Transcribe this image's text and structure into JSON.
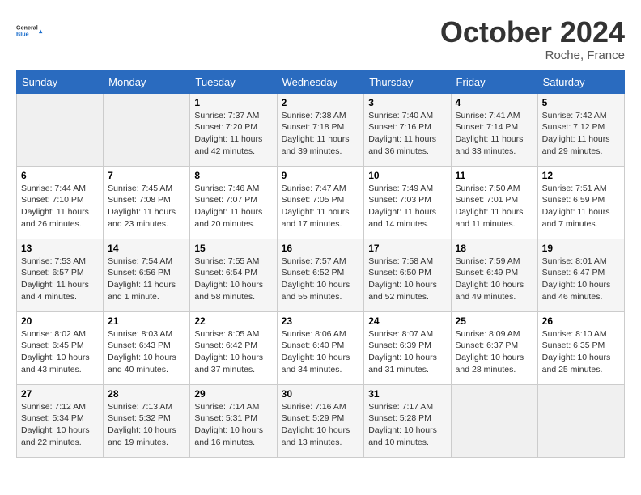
{
  "header": {
    "logo_line1": "General",
    "logo_line2": "Blue",
    "month": "October 2024",
    "location": "Roche, France"
  },
  "days_of_week": [
    "Sunday",
    "Monday",
    "Tuesday",
    "Wednesday",
    "Thursday",
    "Friday",
    "Saturday"
  ],
  "weeks": [
    [
      null,
      null,
      {
        "day": "1",
        "sunrise": "Sunrise: 7:37 AM",
        "sunset": "Sunset: 7:20 PM",
        "daylight": "Daylight: 11 hours and 42 minutes."
      },
      {
        "day": "2",
        "sunrise": "Sunrise: 7:38 AM",
        "sunset": "Sunset: 7:18 PM",
        "daylight": "Daylight: 11 hours and 39 minutes."
      },
      {
        "day": "3",
        "sunrise": "Sunrise: 7:40 AM",
        "sunset": "Sunset: 7:16 PM",
        "daylight": "Daylight: 11 hours and 36 minutes."
      },
      {
        "day": "4",
        "sunrise": "Sunrise: 7:41 AM",
        "sunset": "Sunset: 7:14 PM",
        "daylight": "Daylight: 11 hours and 33 minutes."
      },
      {
        "day": "5",
        "sunrise": "Sunrise: 7:42 AM",
        "sunset": "Sunset: 7:12 PM",
        "daylight": "Daylight: 11 hours and 29 minutes."
      }
    ],
    [
      {
        "day": "6",
        "sunrise": "Sunrise: 7:44 AM",
        "sunset": "Sunset: 7:10 PM",
        "daylight": "Daylight: 11 hours and 26 minutes."
      },
      {
        "day": "7",
        "sunrise": "Sunrise: 7:45 AM",
        "sunset": "Sunset: 7:08 PM",
        "daylight": "Daylight: 11 hours and 23 minutes."
      },
      {
        "day": "8",
        "sunrise": "Sunrise: 7:46 AM",
        "sunset": "Sunset: 7:07 PM",
        "daylight": "Daylight: 11 hours and 20 minutes."
      },
      {
        "day": "9",
        "sunrise": "Sunrise: 7:47 AM",
        "sunset": "Sunset: 7:05 PM",
        "daylight": "Daylight: 11 hours and 17 minutes."
      },
      {
        "day": "10",
        "sunrise": "Sunrise: 7:49 AM",
        "sunset": "Sunset: 7:03 PM",
        "daylight": "Daylight: 11 hours and 14 minutes."
      },
      {
        "day": "11",
        "sunrise": "Sunrise: 7:50 AM",
        "sunset": "Sunset: 7:01 PM",
        "daylight": "Daylight: 11 hours and 11 minutes."
      },
      {
        "day": "12",
        "sunrise": "Sunrise: 7:51 AM",
        "sunset": "Sunset: 6:59 PM",
        "daylight": "Daylight: 11 hours and 7 minutes."
      }
    ],
    [
      {
        "day": "13",
        "sunrise": "Sunrise: 7:53 AM",
        "sunset": "Sunset: 6:57 PM",
        "daylight": "Daylight: 11 hours and 4 minutes."
      },
      {
        "day": "14",
        "sunrise": "Sunrise: 7:54 AM",
        "sunset": "Sunset: 6:56 PM",
        "daylight": "Daylight: 11 hours and 1 minute."
      },
      {
        "day": "15",
        "sunrise": "Sunrise: 7:55 AM",
        "sunset": "Sunset: 6:54 PM",
        "daylight": "Daylight: 10 hours and 58 minutes."
      },
      {
        "day": "16",
        "sunrise": "Sunrise: 7:57 AM",
        "sunset": "Sunset: 6:52 PM",
        "daylight": "Daylight: 10 hours and 55 minutes."
      },
      {
        "day": "17",
        "sunrise": "Sunrise: 7:58 AM",
        "sunset": "Sunset: 6:50 PM",
        "daylight": "Daylight: 10 hours and 52 minutes."
      },
      {
        "day": "18",
        "sunrise": "Sunrise: 7:59 AM",
        "sunset": "Sunset: 6:49 PM",
        "daylight": "Daylight: 10 hours and 49 minutes."
      },
      {
        "day": "19",
        "sunrise": "Sunrise: 8:01 AM",
        "sunset": "Sunset: 6:47 PM",
        "daylight": "Daylight: 10 hours and 46 minutes."
      }
    ],
    [
      {
        "day": "20",
        "sunrise": "Sunrise: 8:02 AM",
        "sunset": "Sunset: 6:45 PM",
        "daylight": "Daylight: 10 hours and 43 minutes."
      },
      {
        "day": "21",
        "sunrise": "Sunrise: 8:03 AM",
        "sunset": "Sunset: 6:43 PM",
        "daylight": "Daylight: 10 hours and 40 minutes."
      },
      {
        "day": "22",
        "sunrise": "Sunrise: 8:05 AM",
        "sunset": "Sunset: 6:42 PM",
        "daylight": "Daylight: 10 hours and 37 minutes."
      },
      {
        "day": "23",
        "sunrise": "Sunrise: 8:06 AM",
        "sunset": "Sunset: 6:40 PM",
        "daylight": "Daylight: 10 hours and 34 minutes."
      },
      {
        "day": "24",
        "sunrise": "Sunrise: 8:07 AM",
        "sunset": "Sunset: 6:39 PM",
        "daylight": "Daylight: 10 hours and 31 minutes."
      },
      {
        "day": "25",
        "sunrise": "Sunrise: 8:09 AM",
        "sunset": "Sunset: 6:37 PM",
        "daylight": "Daylight: 10 hours and 28 minutes."
      },
      {
        "day": "26",
        "sunrise": "Sunrise: 8:10 AM",
        "sunset": "Sunset: 6:35 PM",
        "daylight": "Daylight: 10 hours and 25 minutes."
      }
    ],
    [
      {
        "day": "27",
        "sunrise": "Sunrise: 7:12 AM",
        "sunset": "Sunset: 5:34 PM",
        "daylight": "Daylight: 10 hours and 22 minutes."
      },
      {
        "day": "28",
        "sunrise": "Sunrise: 7:13 AM",
        "sunset": "Sunset: 5:32 PM",
        "daylight": "Daylight: 10 hours and 19 minutes."
      },
      {
        "day": "29",
        "sunrise": "Sunrise: 7:14 AM",
        "sunset": "Sunset: 5:31 PM",
        "daylight": "Daylight: 10 hours and 16 minutes."
      },
      {
        "day": "30",
        "sunrise": "Sunrise: 7:16 AM",
        "sunset": "Sunset: 5:29 PM",
        "daylight": "Daylight: 10 hours and 13 minutes."
      },
      {
        "day": "31",
        "sunrise": "Sunrise: 7:17 AM",
        "sunset": "Sunset: 5:28 PM",
        "daylight": "Daylight: 10 hours and 10 minutes."
      },
      null,
      null
    ]
  ]
}
